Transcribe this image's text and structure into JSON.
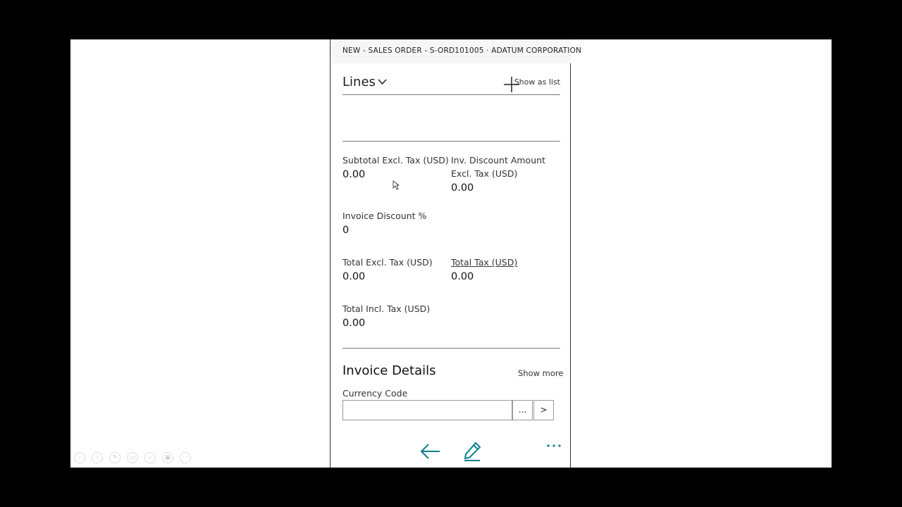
{
  "header": {
    "title": "NEW - SALES ORDER - S-ORD101005 · ADATUM CORPORATION"
  },
  "lines": {
    "title": "Lines",
    "show_as_list": "Show as list",
    "add_icon": "plus-icon",
    "expand_icon": "chevron-down-icon"
  },
  "totals": {
    "subtotal_label": "Subtotal Excl. Tax (USD)",
    "subtotal_value": "0.00",
    "inv_discount_label_1": "Inv. Discount Amount",
    "inv_discount_label_2": "Excl. Tax (USD)",
    "inv_discount_value": "0.00",
    "invoice_discount_pct_label": "Invoice Discount %",
    "invoice_discount_pct_value": "0",
    "total_excl_label": "Total Excl. Tax (USD)",
    "total_excl_value": "0.00",
    "total_tax_label": "Total Tax (USD)",
    "total_tax_value": "0.00",
    "total_incl_label": "Total Incl. Tax (USD)",
    "total_incl_value": "0.00"
  },
  "invoice_details": {
    "title": "Invoice Details",
    "show_more": "Show more",
    "currency_code_label": "Currency Code",
    "currency_code_value": "",
    "lookup_button": "...",
    "next_button": ">"
  },
  "bottom_bar": {
    "back_icon": "back-arrow-icon",
    "edit_icon": "pencil-icon",
    "more_icon": "more-dots-icon",
    "accent_color": "#0a7f8c"
  },
  "presentation_toolbar": {
    "icons": [
      "previous-icon",
      "next-icon",
      "pen-icon",
      "slides-icon",
      "zoom-icon",
      "screen-icon",
      "more-icon"
    ]
  }
}
